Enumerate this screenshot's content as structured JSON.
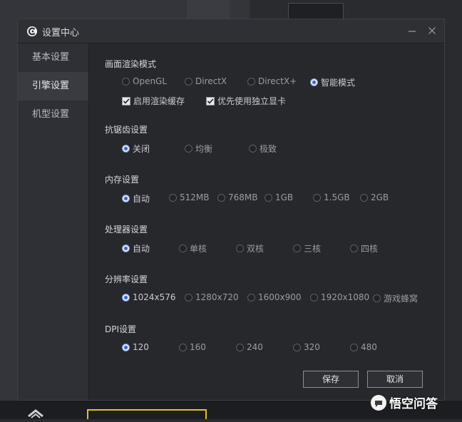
{
  "dialog": {
    "title": "设置中心"
  },
  "sidebar": {
    "items": [
      {
        "label": "基本设置",
        "active": false
      },
      {
        "label": "引擎设置",
        "active": true
      },
      {
        "label": "机型设置",
        "active": false
      }
    ]
  },
  "render_mode": {
    "title": "画面渲染模式",
    "options": [
      "OpenGL",
      "DirectX",
      "DirectX+",
      "智能模式"
    ],
    "selected": "智能模式",
    "checkboxes": [
      {
        "label": "启用渲染缓存",
        "checked": true
      },
      {
        "label": "优先使用独立显卡",
        "checked": true
      }
    ]
  },
  "antialias": {
    "title": "抗锯齿设置",
    "options": [
      "关闭",
      "均衡",
      "极致"
    ],
    "selected": "关闭"
  },
  "memory": {
    "title": "内存设置",
    "options": [
      "自动",
      "512MB",
      "768MB",
      "1GB",
      "1.5GB",
      "2GB"
    ],
    "selected": "自动"
  },
  "cpu": {
    "title": "处理器设置",
    "options": [
      "自动",
      "单核",
      "双核",
      "三核",
      "四核"
    ],
    "selected": "自动"
  },
  "resolution": {
    "title": "分辨率设置",
    "options": [
      "1024x576",
      "1280x720",
      "1600x900",
      "1920x1080",
      "游戏蜂窝"
    ],
    "selected": "1024x576"
  },
  "dpi": {
    "title": "DPI设置",
    "options": [
      "120",
      "160",
      "240",
      "320",
      "480"
    ],
    "selected": "120"
  },
  "buttons": {
    "save": "保存",
    "cancel": "取消"
  },
  "watermark": {
    "text": "悟空问答"
  },
  "colors": {
    "accent": "#3e68c4",
    "dialog_bg": "#27282c",
    "sidebar_bg": "#2f3035",
    "watermark_yellow": "#e3c125"
  }
}
